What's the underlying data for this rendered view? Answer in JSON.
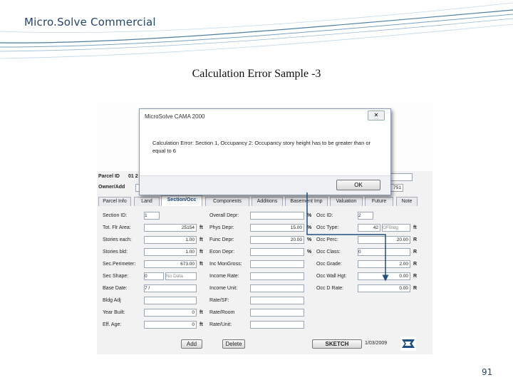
{
  "slide": {
    "title": "Micro.Solve Commercial",
    "heading": "Calculation Error  Sample -3",
    "page_number": "91"
  },
  "dialog": {
    "title": "MicroSolve CAMA 2000",
    "message": "Calculation Error: Section 1, Occupancy 2: Occupancy story height has to be greater than or equal to 6",
    "ok_label": "OK",
    "close_glyph": "✕"
  },
  "header": {
    "parcel_id_label": "Parcel ID",
    "parcel_id_value": "01 2",
    "owner_label": "Owner/Add",
    "owner_value": "751"
  },
  "tabs": [
    "Parcel Info",
    "Land",
    "Section/Occ",
    "Components",
    "Additions",
    "Basement Imp",
    "Valuation",
    "Future",
    "Note"
  ],
  "left_fields": [
    {
      "label": "Section ID:",
      "value": "1",
      "unit": ""
    },
    {
      "label": "Tot. Flr Area:",
      "value": "25154",
      "unit": "ft"
    },
    {
      "label": "Stories each:",
      "value": "1.00",
      "unit": "ft"
    },
    {
      "label": "Stories bld:",
      "value": "1.00",
      "unit": "ft"
    },
    {
      "label": "Sec.Perimeter:",
      "value": "673.00",
      "unit": "ft"
    },
    {
      "label": "Sec Shape:",
      "value": "0",
      "unit": ""
    },
    {
      "label": "Base Date:",
      "value": "7 /",
      "unit": ""
    },
    {
      "label": "Bldg Adj",
      "value": "",
      "unit": ""
    },
    {
      "label": "Year Built:",
      "value": "0",
      "unit": "ft"
    },
    {
      "label": "Eff. Age:",
      "value": "0",
      "unit": "ft"
    }
  ],
  "shape_hint": "No Data",
  "mid_fields": [
    {
      "label": "Overall Depr:",
      "value": "",
      "unit": "%"
    },
    {
      "label": "Phys Depr:",
      "value": "15.00",
      "unit": "%"
    },
    {
      "label": "Func Depr:",
      "value": "20.00",
      "unit": "%"
    },
    {
      "label": "Econ Depr:",
      "value": "",
      "unit": "%"
    },
    {
      "label": "Inc MonGross:",
      "value": "",
      "unit": ""
    },
    {
      "label": "Income Rate:",
      "value": "",
      "unit": ""
    },
    {
      "label": "Income Unit:",
      "value": "",
      "unit": ""
    },
    {
      "label": "Rate/SF:",
      "value": "",
      "unit": ""
    },
    {
      "label": "Rate/Room",
      "value": "",
      "unit": ""
    },
    {
      "label": "Rate/Unit:",
      "value": "",
      "unit": ""
    }
  ],
  "right_fields": [
    {
      "label": "Occ ID:",
      "value": "2",
      "unit": ""
    },
    {
      "label": "Occ Type:",
      "value": "42",
      "unit": "ft"
    },
    {
      "label": "Occ Perc:",
      "value": "20.00",
      "unit": "R"
    },
    {
      "label": "Occ Class:",
      "value": "0",
      "unit": "R"
    },
    {
      "label": "Occ Grade:",
      "value": "2.00",
      "unit": "R"
    },
    {
      "label": "Occ Wall Hgt:",
      "value": "0.00",
      "unit": "R"
    },
    {
      "label": "Occ D Rate:",
      "value": "0.00",
      "unit": "R"
    }
  ],
  "occ_type_hint": "OFBldg",
  "buttons": {
    "add": "Add",
    "delete": "Delete",
    "sketch": "SKETCH"
  },
  "date_text": "1/03/2009",
  "colors": {
    "swoosh": "#4f7fa6",
    "arrow": "#1f4f80",
    "brand": "#24466b"
  }
}
